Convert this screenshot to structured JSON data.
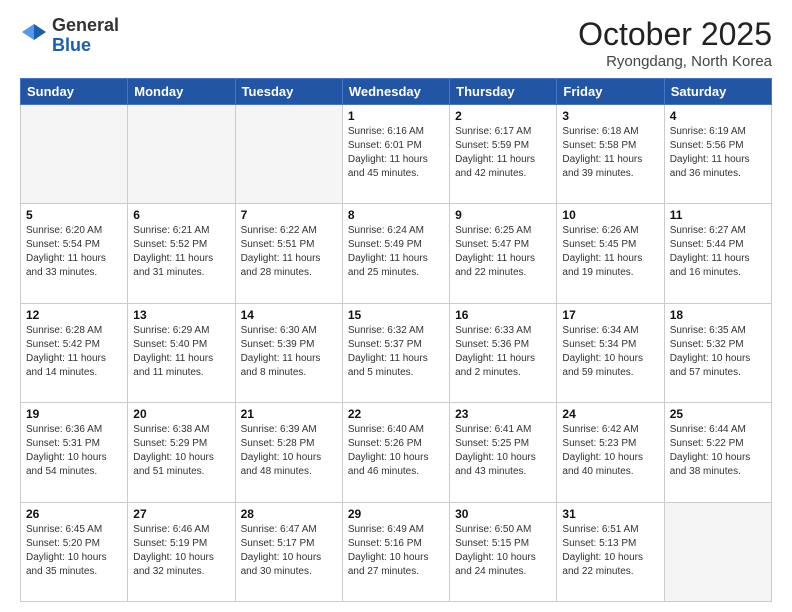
{
  "header": {
    "logo_general": "General",
    "logo_blue": "Blue",
    "month_title": "October 2025",
    "location": "Ryongdang, North Korea"
  },
  "days_of_week": [
    "Sunday",
    "Monday",
    "Tuesday",
    "Wednesday",
    "Thursday",
    "Friday",
    "Saturday"
  ],
  "weeks": [
    [
      {
        "day": "",
        "text": ""
      },
      {
        "day": "",
        "text": ""
      },
      {
        "day": "",
        "text": ""
      },
      {
        "day": "1",
        "text": "Sunrise: 6:16 AM\nSunset: 6:01 PM\nDaylight: 11 hours\nand 45 minutes."
      },
      {
        "day": "2",
        "text": "Sunrise: 6:17 AM\nSunset: 5:59 PM\nDaylight: 11 hours\nand 42 minutes."
      },
      {
        "day": "3",
        "text": "Sunrise: 6:18 AM\nSunset: 5:58 PM\nDaylight: 11 hours\nand 39 minutes."
      },
      {
        "day": "4",
        "text": "Sunrise: 6:19 AM\nSunset: 5:56 PM\nDaylight: 11 hours\nand 36 minutes."
      }
    ],
    [
      {
        "day": "5",
        "text": "Sunrise: 6:20 AM\nSunset: 5:54 PM\nDaylight: 11 hours\nand 33 minutes."
      },
      {
        "day": "6",
        "text": "Sunrise: 6:21 AM\nSunset: 5:52 PM\nDaylight: 11 hours\nand 31 minutes."
      },
      {
        "day": "7",
        "text": "Sunrise: 6:22 AM\nSunset: 5:51 PM\nDaylight: 11 hours\nand 28 minutes."
      },
      {
        "day": "8",
        "text": "Sunrise: 6:24 AM\nSunset: 5:49 PM\nDaylight: 11 hours\nand 25 minutes."
      },
      {
        "day": "9",
        "text": "Sunrise: 6:25 AM\nSunset: 5:47 PM\nDaylight: 11 hours\nand 22 minutes."
      },
      {
        "day": "10",
        "text": "Sunrise: 6:26 AM\nSunset: 5:45 PM\nDaylight: 11 hours\nand 19 minutes."
      },
      {
        "day": "11",
        "text": "Sunrise: 6:27 AM\nSunset: 5:44 PM\nDaylight: 11 hours\nand 16 minutes."
      }
    ],
    [
      {
        "day": "12",
        "text": "Sunrise: 6:28 AM\nSunset: 5:42 PM\nDaylight: 11 hours\nand 14 minutes."
      },
      {
        "day": "13",
        "text": "Sunrise: 6:29 AM\nSunset: 5:40 PM\nDaylight: 11 hours\nand 11 minutes."
      },
      {
        "day": "14",
        "text": "Sunrise: 6:30 AM\nSunset: 5:39 PM\nDaylight: 11 hours\nand 8 minutes."
      },
      {
        "day": "15",
        "text": "Sunrise: 6:32 AM\nSunset: 5:37 PM\nDaylight: 11 hours\nand 5 minutes."
      },
      {
        "day": "16",
        "text": "Sunrise: 6:33 AM\nSunset: 5:36 PM\nDaylight: 11 hours\nand 2 minutes."
      },
      {
        "day": "17",
        "text": "Sunrise: 6:34 AM\nSunset: 5:34 PM\nDaylight: 10 hours\nand 59 minutes."
      },
      {
        "day": "18",
        "text": "Sunrise: 6:35 AM\nSunset: 5:32 PM\nDaylight: 10 hours\nand 57 minutes."
      }
    ],
    [
      {
        "day": "19",
        "text": "Sunrise: 6:36 AM\nSunset: 5:31 PM\nDaylight: 10 hours\nand 54 minutes."
      },
      {
        "day": "20",
        "text": "Sunrise: 6:38 AM\nSunset: 5:29 PM\nDaylight: 10 hours\nand 51 minutes."
      },
      {
        "day": "21",
        "text": "Sunrise: 6:39 AM\nSunset: 5:28 PM\nDaylight: 10 hours\nand 48 minutes."
      },
      {
        "day": "22",
        "text": "Sunrise: 6:40 AM\nSunset: 5:26 PM\nDaylight: 10 hours\nand 46 minutes."
      },
      {
        "day": "23",
        "text": "Sunrise: 6:41 AM\nSunset: 5:25 PM\nDaylight: 10 hours\nand 43 minutes."
      },
      {
        "day": "24",
        "text": "Sunrise: 6:42 AM\nSunset: 5:23 PM\nDaylight: 10 hours\nand 40 minutes."
      },
      {
        "day": "25",
        "text": "Sunrise: 6:44 AM\nSunset: 5:22 PM\nDaylight: 10 hours\nand 38 minutes."
      }
    ],
    [
      {
        "day": "26",
        "text": "Sunrise: 6:45 AM\nSunset: 5:20 PM\nDaylight: 10 hours\nand 35 minutes."
      },
      {
        "day": "27",
        "text": "Sunrise: 6:46 AM\nSunset: 5:19 PM\nDaylight: 10 hours\nand 32 minutes."
      },
      {
        "day": "28",
        "text": "Sunrise: 6:47 AM\nSunset: 5:17 PM\nDaylight: 10 hours\nand 30 minutes."
      },
      {
        "day": "29",
        "text": "Sunrise: 6:49 AM\nSunset: 5:16 PM\nDaylight: 10 hours\nand 27 minutes."
      },
      {
        "day": "30",
        "text": "Sunrise: 6:50 AM\nSunset: 5:15 PM\nDaylight: 10 hours\nand 24 minutes."
      },
      {
        "day": "31",
        "text": "Sunrise: 6:51 AM\nSunset: 5:13 PM\nDaylight: 10 hours\nand 22 minutes."
      },
      {
        "day": "",
        "text": ""
      }
    ]
  ]
}
